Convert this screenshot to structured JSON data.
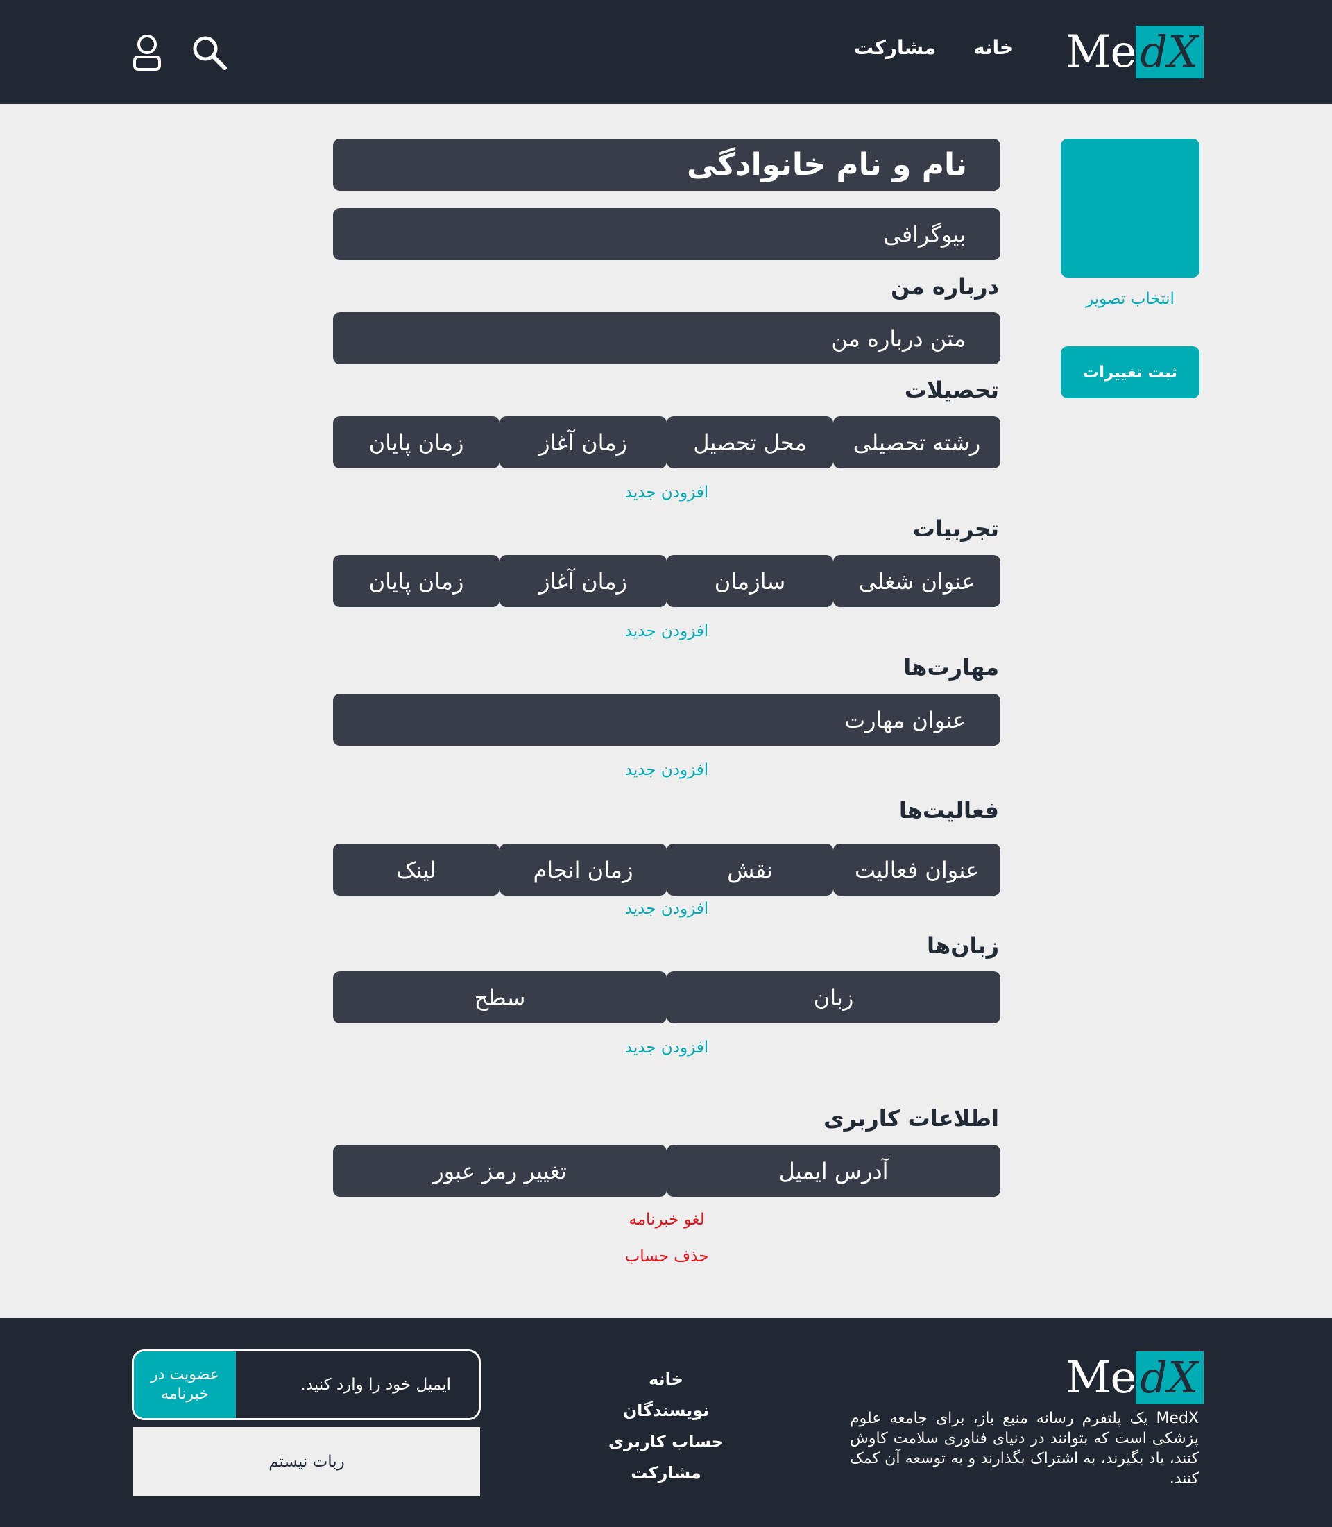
{
  "header": {
    "logo": {
      "me": "Me",
      "dx": "dX"
    },
    "nav": {
      "home": "خانه",
      "contribute": "مشارکت"
    },
    "icons": {
      "search": "search-icon",
      "user": "user-icon"
    }
  },
  "sidebar": {
    "choose_image": "انتخاب تصویر",
    "save_changes": "ثبت تغییرات"
  },
  "profile": {
    "full_name_placeholder": "نام و نام خانوادگی",
    "biography_placeholder": "بیوگرافی",
    "about": {
      "label": "درباره من",
      "placeholder": "متن درباره من"
    },
    "education": {
      "label": "تحصیلات",
      "columns": [
        "رشته تحصیلی",
        "محل تحصیل",
        "زمان آغاز",
        "زمان پایان"
      ],
      "add": "افزودن جدید"
    },
    "experience": {
      "label": "تجربیات",
      "columns": [
        "عنوان شغلی",
        "سازمان",
        "زمان آغاز",
        "زمان پایان"
      ],
      "add": "افزودن جدید"
    },
    "skills": {
      "label": "مهارت‌ها",
      "placeholder": "عنوان مهارت",
      "add": "افزودن جدید"
    },
    "activities": {
      "label": "فعالیت‌ها",
      "columns": [
        "عنوان فعالیت",
        "نقش",
        "زمان انجام",
        "لینک"
      ],
      "add": "افزودن جدید"
    },
    "languages": {
      "label": "زبان‌ها",
      "columns": [
        "زبان",
        "سطح"
      ],
      "add": "افزودن جدید"
    },
    "user_info": {
      "label": "اطلاعات کاربری",
      "columns": [
        "آدرس ایمیل",
        "تغییر رمز عبور"
      ]
    },
    "unsubscribe": "لغو خبرنامه",
    "delete_account": "حذف حساب"
  },
  "footer": {
    "logo": {
      "me": "Me",
      "dx": "dX"
    },
    "description": "MedX یک پلتفرم رسانه منبع باز، برای جامعه علوم پزشکی است که بتوانند در دنیای فناوری سلامت کاوش کنند، یاد بگیرند، به اشتراک بگذارند و به توسعه آن کمک کنند.",
    "links": [
      "خانه",
      "نویسندگان",
      "حساب کاربری",
      "مشارکت"
    ],
    "newsletter": {
      "placeholder": "ایمیل خود را وارد کنید.",
      "button": "عضویت در خبرنامه"
    },
    "captcha": "ربات نیستم"
  },
  "colors": {
    "accent": "#00adb5",
    "dark": "#212733",
    "field": "#393d49",
    "danger": "#e8121b",
    "background": "#eeeeee"
  }
}
